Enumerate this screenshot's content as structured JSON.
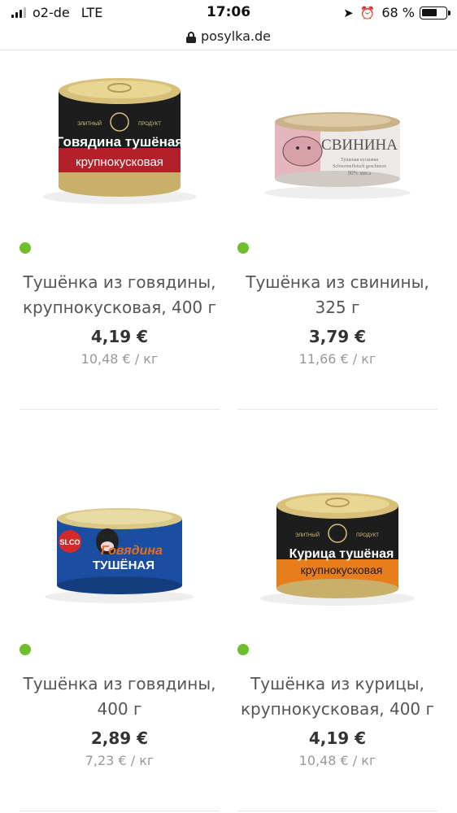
{
  "status_bar": {
    "carrier": "o2-de",
    "network": "LTE",
    "time": "17:06",
    "battery_percent": "68 %",
    "battery_level": 0.68
  },
  "browser": {
    "url": "posylka.de"
  },
  "products": [
    {
      "image_icon": "canned-beef-chunks-image",
      "name": "Тушёнка из говядины, крупнокусковая, 400 г",
      "price": "4,19 €",
      "unit_price": "10,48 € / кг",
      "availability_color": "#6ebe2e"
    },
    {
      "image_icon": "canned-pork-image",
      "name": "Тушёнка из свинины, 325 г",
      "price": "3,79 €",
      "unit_price": "11,66 € / кг",
      "availability_color": "#6ebe2e"
    },
    {
      "image_icon": "canned-beef-image",
      "name": "Тушёнка из говядины, 400 г",
      "price": "2,89 €",
      "unit_price": "7,23 € / кг",
      "availability_color": "#6ebe2e"
    },
    {
      "image_icon": "canned-chicken-image",
      "name": "Тушёнка из курицы, крупнокусковая, 400 г",
      "price": "4,19 €",
      "unit_price": "10,48 € / кг",
      "availability_color": "#6ebe2e"
    }
  ]
}
